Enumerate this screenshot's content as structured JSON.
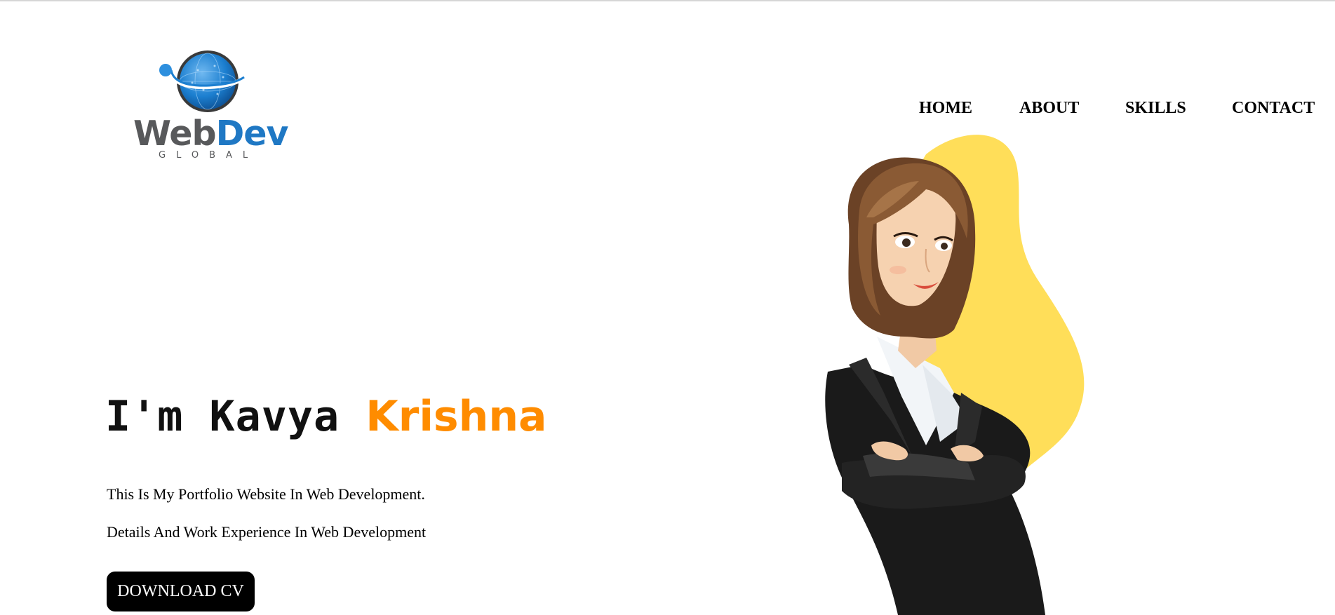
{
  "logo": {
    "word_web": "Web",
    "word_dev": "Dev",
    "subtitle": "GLOBAL",
    "icon": "globe-orbit-icon"
  },
  "nav": {
    "items": [
      {
        "label": "HOME"
      },
      {
        "label": "ABOUT"
      },
      {
        "label": "SKILLS"
      },
      {
        "label": "CONTACT"
      }
    ]
  },
  "hero": {
    "title_first": "I'm Kavya ",
    "title_last": "Krishna",
    "line1": "This Is My Portfolio Website In Web Development.",
    "line2": "Details And Work Experience In Web Development",
    "button_label": "DOWNLOAD CV"
  },
  "colors": {
    "accent_orange": "#ff8c00",
    "blob_yellow": "#ffde59",
    "logo_blue": "#1f78c4",
    "logo_gray": "#58595b",
    "button_black": "#000000"
  }
}
